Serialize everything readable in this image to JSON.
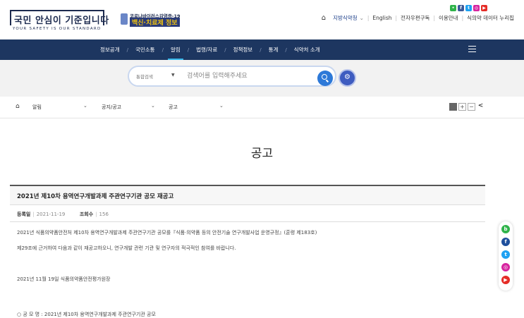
{
  "header": {
    "logo_main": "국민 안심이 기준입니다",
    "logo_sub": "YOUR SAFETY IS OUR STANDARD",
    "campaign_top": "코로나바이러스감염증-19",
    "campaign_main": "백신·치료제 정보",
    "social": [
      "chat",
      "f",
      "tw",
      "ig",
      "yt"
    ],
    "util_links": [
      "지방식약청",
      "English",
      "전자우편구독",
      "이용안내",
      "식의약 데이터 누리집"
    ]
  },
  "nav": {
    "items": [
      "정보공개",
      "국민소통",
      "알림",
      "법령/자료",
      "정책정보",
      "통계",
      "식약처 소개"
    ],
    "active_index": 2
  },
  "search": {
    "scope": "통합검색",
    "placeholder": "검색어를 입력해주세요"
  },
  "breadcrumb": {
    "items": [
      "알림",
      "공지/공고",
      "공고"
    ]
  },
  "page_title": "공고",
  "post": {
    "title": "2021년 제10차 용역연구개발과제 주관연구기관 공모 재공고",
    "date_label": "등록일",
    "date": "2021-11-19",
    "views_label": "조회수",
    "views": "156",
    "paragraphs": [
      "2021년 식품의약품안전처 제10차 용역연구개발과제 주관연구기관 공모를『식품·의약품 등의 안전기술 연구개발사업 운영규정』(훈령 제183호)",
      "제29조에 근거하여 다음과 같이 재공고하오니, 연구개발 관련 기관 및 연구자의 적극적인 참여를 바랍니다.",
      "2021년 11월 19일 식품의약품안전평가원장"
    ],
    "notice_line": "○ 공 모 명 : 2021년 제10차 용역연구개발과제 주관연구기관 공모"
  },
  "float_social": [
    "b",
    "f",
    "t",
    "i",
    "y"
  ],
  "colors": {
    "nav_bg": "#1d3660",
    "accent": "#36b6e9",
    "search_btn": "#2d79d8"
  }
}
